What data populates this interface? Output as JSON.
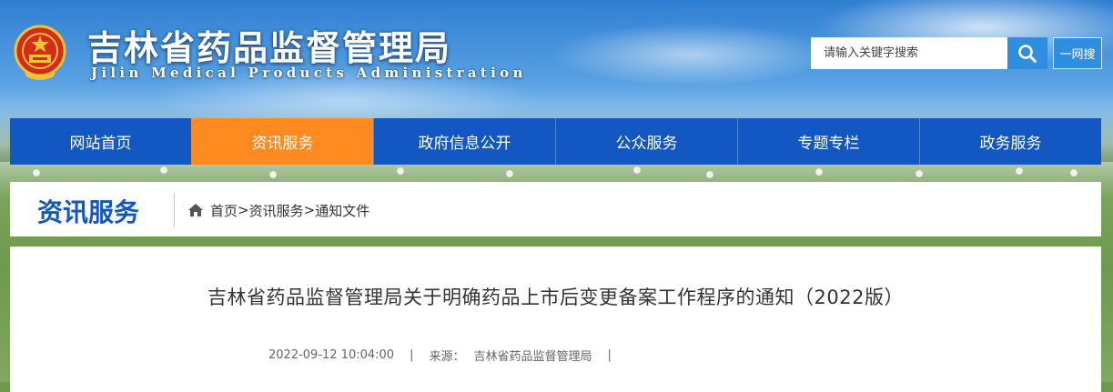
{
  "header": {
    "title": "吉林省药品监督管理局",
    "subtitle": "Jilin Medical Products Administration",
    "emblem_icon": "national-emblem-icon"
  },
  "search": {
    "placeholder": "请输入关键字搜索",
    "button_icon": "search-icon",
    "one_net_label": "一网搜"
  },
  "nav": {
    "items": [
      {
        "label": "网站首页"
      },
      {
        "label": "资讯服务"
      },
      {
        "label": "政府信息公开"
      },
      {
        "label": "公众服务"
      },
      {
        "label": "专题专栏"
      },
      {
        "label": "政务服务"
      }
    ],
    "active_index": 1
  },
  "section": {
    "title": "资讯服务",
    "breadcrumb": [
      {
        "label": "首页"
      },
      {
        "label": "资讯服务"
      },
      {
        "label": "通知文件"
      }
    ],
    "separator": ">"
  },
  "article": {
    "title": "吉林省药品监督管理局关于明确药品上市后变更备案工作程序的通知（2022版）",
    "datetime": "2022-09-12 10:04:00",
    "source_label": "来源：",
    "source": "吉林省药品监督管理局",
    "separator": "|"
  },
  "colors": {
    "nav_blue": "#1257c2",
    "nav_active": "#ff8a1f",
    "search_blue": "#2f8ee0",
    "section_title": "#1457c1"
  }
}
